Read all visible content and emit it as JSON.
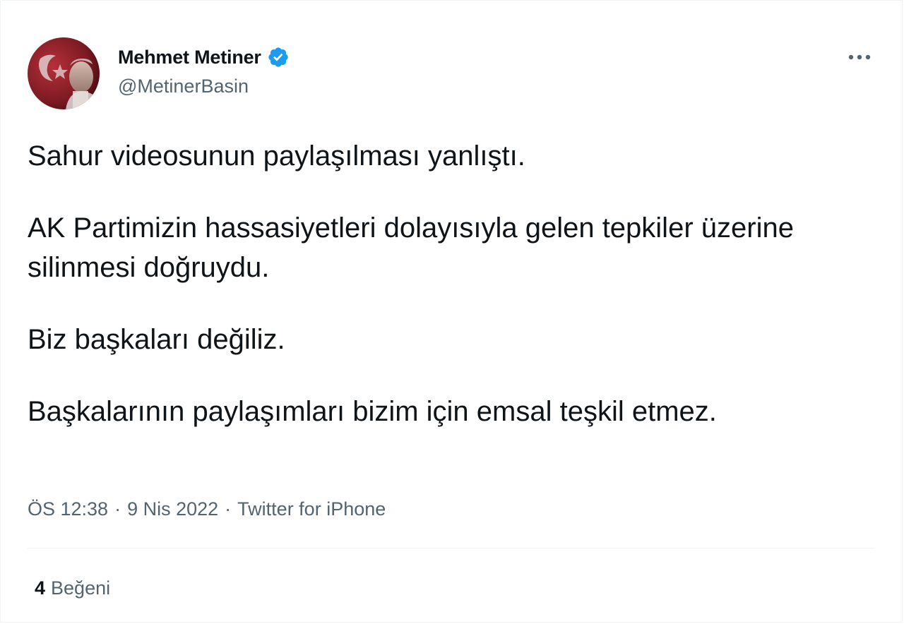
{
  "author": {
    "display_name": "Mehmet Metiner",
    "handle": "@MetinerBasin",
    "verified": true,
    "avatar_icon": "profile-photo"
  },
  "menu": {
    "icon": "more-horizontal-icon"
  },
  "tweet": {
    "paragraphs": [
      "Sahur videosunun paylaşılması yanlıştı.",
      "AK Partimizin hassasiyetleri dolayısıyla gelen tepkiler üzerine silinmesi doğruydu.",
      "Biz başkaları değiliz.",
      "Başkalarının paylaşımları bizim için emsal teşkil etmez."
    ],
    "time": "ÖS 12:38",
    "date": "9 Nis 2022",
    "separator": "·",
    "source": "Twitter for iPhone"
  },
  "stats": {
    "likes_count": "4",
    "likes_label": "Beğeni"
  },
  "colors": {
    "verified_blue": "#1d9bf0",
    "secondary_text": "#536471",
    "primary_text": "#0f1419",
    "divider": "#eff3f4"
  }
}
